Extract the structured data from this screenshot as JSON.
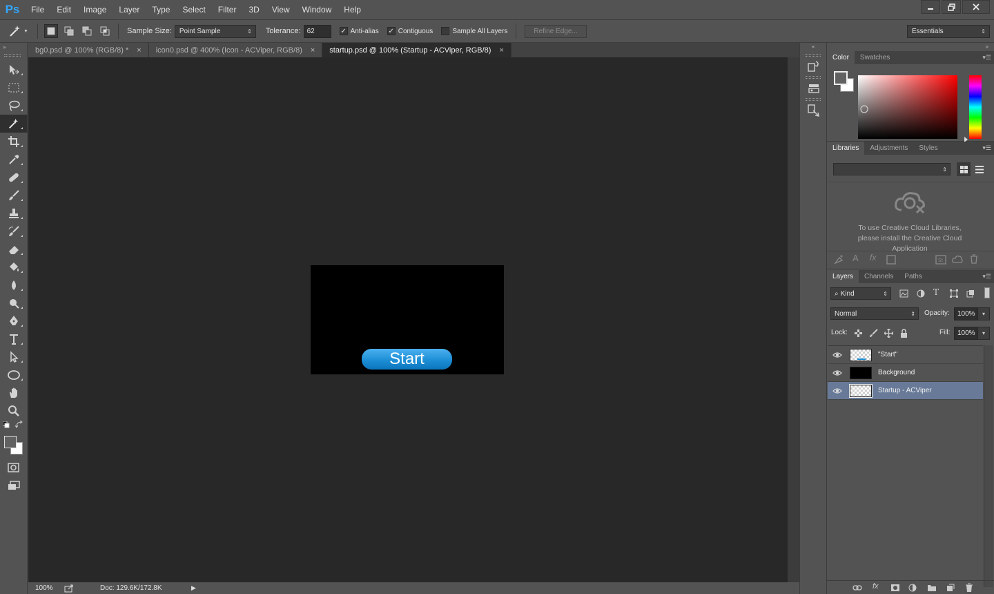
{
  "app": {
    "logo": "Ps"
  },
  "menu": [
    "File",
    "Edit",
    "Image",
    "Layer",
    "Type",
    "Select",
    "Filter",
    "3D",
    "View",
    "Window",
    "Help"
  ],
  "window_controls": {
    "minimize": "minimize-icon",
    "restore": "restore-icon",
    "close": "close-icon"
  },
  "options": {
    "sample_size_label": "Sample Size:",
    "sample_size_value": "Point Sample",
    "tolerance_label": "Tolerance:",
    "tolerance_value": "62",
    "anti_alias_label": "Anti-alias",
    "anti_alias_checked": true,
    "contiguous_label": "Contiguous",
    "contiguous_checked": true,
    "sample_all_layers_label": "Sample All Layers",
    "sample_all_layers_checked": false,
    "refine_edge_label": "Refine Edge...",
    "workspace": "Essentials"
  },
  "tabs": [
    {
      "label": "bg0.psd @ 100% (RGB/8) *",
      "active": false
    },
    {
      "label": "icon0.psd @ 400% (Icon - ACViper, RGB/8)",
      "active": false
    },
    {
      "label": "startup.psd @ 100% (Startup - ACViper, RGB/8)",
      "active": true
    }
  ],
  "canvas": {
    "button_text": "Start",
    "document_background": "#000000",
    "button_color": "#1d8fd6"
  },
  "status": {
    "zoom": "100%",
    "doc_info": "Doc: 129.6K/172.8K"
  },
  "color_panel": {
    "tabs": [
      "Color",
      "Swatches"
    ],
    "hue_color": "#ff0000"
  },
  "libraries_panel": {
    "tabs": [
      "Libraries",
      "Adjustments",
      "Styles"
    ],
    "message": "To use Creative Cloud Libraries, please install the Creative Cloud Application"
  },
  "layers_panel": {
    "tabs": [
      "Layers",
      "Channels",
      "Paths"
    ],
    "filter_label": "Kind",
    "blend_mode": "Normal",
    "opacity_label": "Opacity:",
    "opacity_value": "100%",
    "lock_label": "Lock:",
    "fill_label": "Fill:",
    "fill_value": "100%",
    "layers": [
      {
        "name": "\"Start\"",
        "thumb": "transparent",
        "selected": false
      },
      {
        "name": "Background",
        "thumb": "black",
        "selected": false
      },
      {
        "name": "Startup - ACViper",
        "thumb": "transparent",
        "selected": true
      }
    ]
  },
  "colors": {
    "accent": "#31a8ff",
    "selection": "#687a98",
    "canvas_bg": "#282828",
    "ui_bg": "#535353"
  }
}
